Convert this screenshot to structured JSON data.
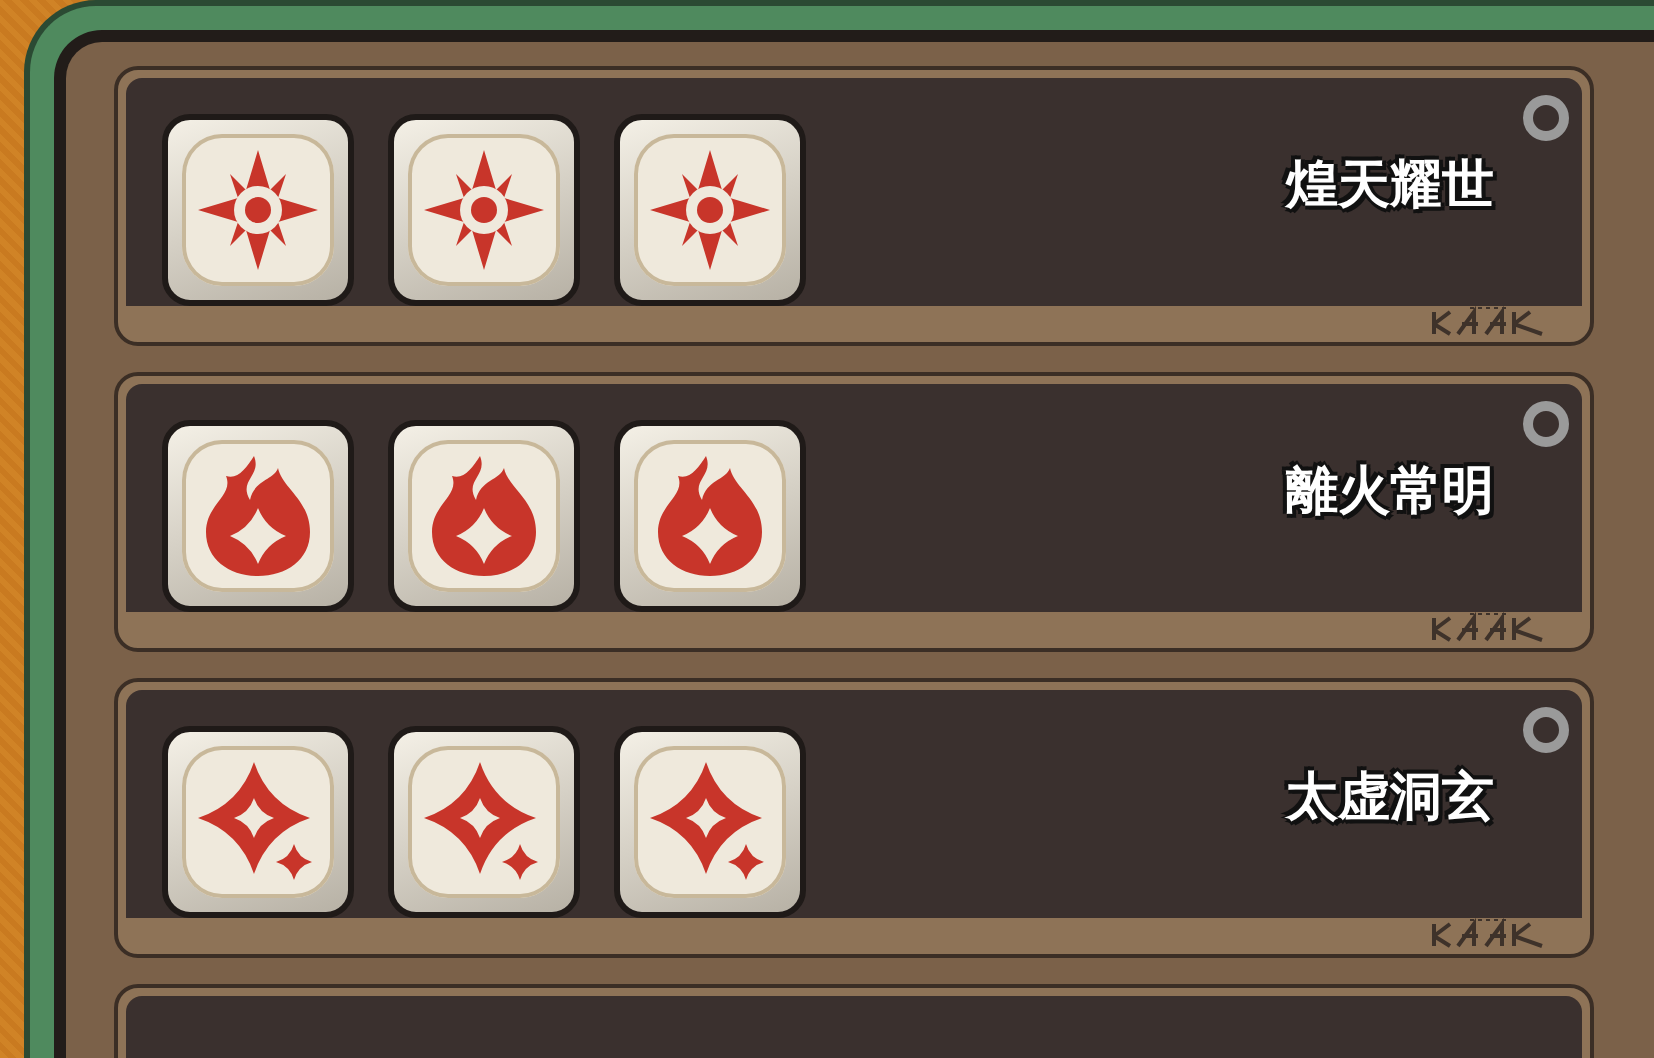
{
  "rows": [
    {
      "title": "煌天耀世",
      "emblems": [
        {
          "kind": "sun"
        },
        {
          "kind": "sun"
        },
        {
          "kind": "sun"
        }
      ]
    },
    {
      "title": "離火常明",
      "emblems": [
        {
          "kind": "flame"
        },
        {
          "kind": "flame"
        },
        {
          "kind": "flame"
        }
      ]
    },
    {
      "title": "太虚洞玄",
      "emblems": [
        {
          "kind": "sparkle"
        },
        {
          "kind": "sparkle"
        },
        {
          "kind": "sparkle"
        }
      ]
    }
  ]
}
